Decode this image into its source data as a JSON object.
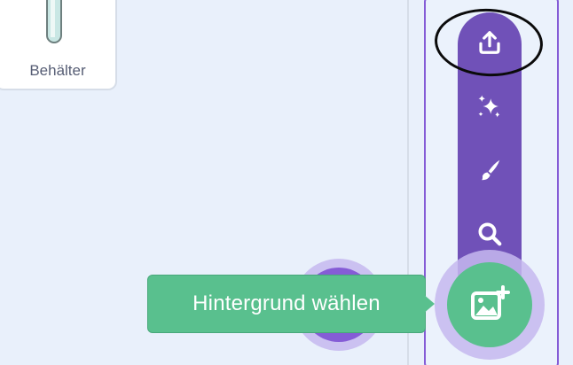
{
  "sprite_tile": {
    "label": "Behälter"
  },
  "backdrop_menu": {
    "items": [
      {
        "name": "upload-backdrop",
        "icon": "upload-icon"
      },
      {
        "name": "surprise",
        "icon": "sparkles-icon"
      },
      {
        "name": "paint",
        "icon": "paintbrush-icon"
      },
      {
        "name": "choose-backdrop-search",
        "icon": "search-icon"
      }
    ],
    "main_button_icon": "image-plus-icon"
  },
  "tooltip": {
    "text": "Hintergrund wählen"
  },
  "colors": {
    "background": "#e9f0fb",
    "menu_purple": "#7051b8",
    "accent_purple": "#855cd6",
    "green": "#59c08e",
    "highlight": "#0b0b0b"
  }
}
